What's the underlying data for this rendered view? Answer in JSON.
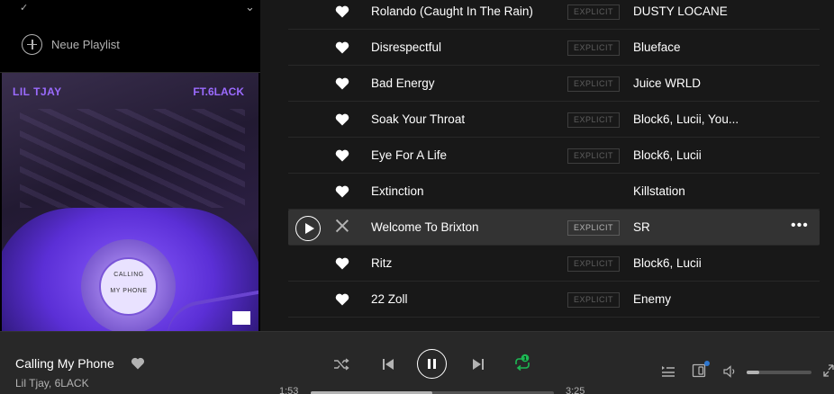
{
  "sidebar": {
    "new_playlist_label": "Neue Playlist",
    "cover": {
      "artist_text": "LIL TJAY",
      "feature_text": "FT.6LACK",
      "dial_text_line1": "CALLING",
      "dial_text_line2": "MY PHONE"
    }
  },
  "tracks": [
    {
      "title": "Rolando (Caught In The Rain)",
      "explicit": "EXPLICIT",
      "artists": "DUSTY LOCANE",
      "liked": true
    },
    {
      "title": "Disrespectful",
      "explicit": "EXPLICIT",
      "artists": "Blueface",
      "liked": true
    },
    {
      "title": "Bad Energy",
      "explicit": "EXPLICIT",
      "artists": "Juice WRLD",
      "liked": true
    },
    {
      "title": "Soak Your Throat",
      "explicit": "EXPLICIT",
      "artists": "Block6, Lucii, You...",
      "liked": true
    },
    {
      "title": "Eye For A Life",
      "explicit": "EXPLICIT",
      "artists": "Block6, Lucii",
      "liked": true
    },
    {
      "title": "Extinction",
      "explicit": "",
      "artists": "Killstation",
      "liked": true
    },
    {
      "title": "Welcome To Brixton",
      "explicit": "EXPLICIT",
      "artists": "SR",
      "selected": true,
      "more": "•••"
    },
    {
      "title": "Ritz",
      "explicit": "EXPLICIT",
      "artists": "Block6, Lucii",
      "liked": true
    },
    {
      "title": "22 Zoll",
      "explicit": "EXPLICIT",
      "artists": "Enemy",
      "liked": true
    }
  ],
  "player": {
    "now_playing_title": "Calling My Phone",
    "now_playing_artist": "Lil Tjay, 6LACK",
    "elapsed": "1:53",
    "duration": "3:25",
    "progress_fraction": 0.5,
    "volume_fraction": 0.2,
    "repeat_badge": "1"
  },
  "colors": {
    "background": "#181818",
    "sidebar": "#000000",
    "player_bar": "#282828",
    "accent_green": "#1db954",
    "device_dot": "#2e77d0"
  }
}
